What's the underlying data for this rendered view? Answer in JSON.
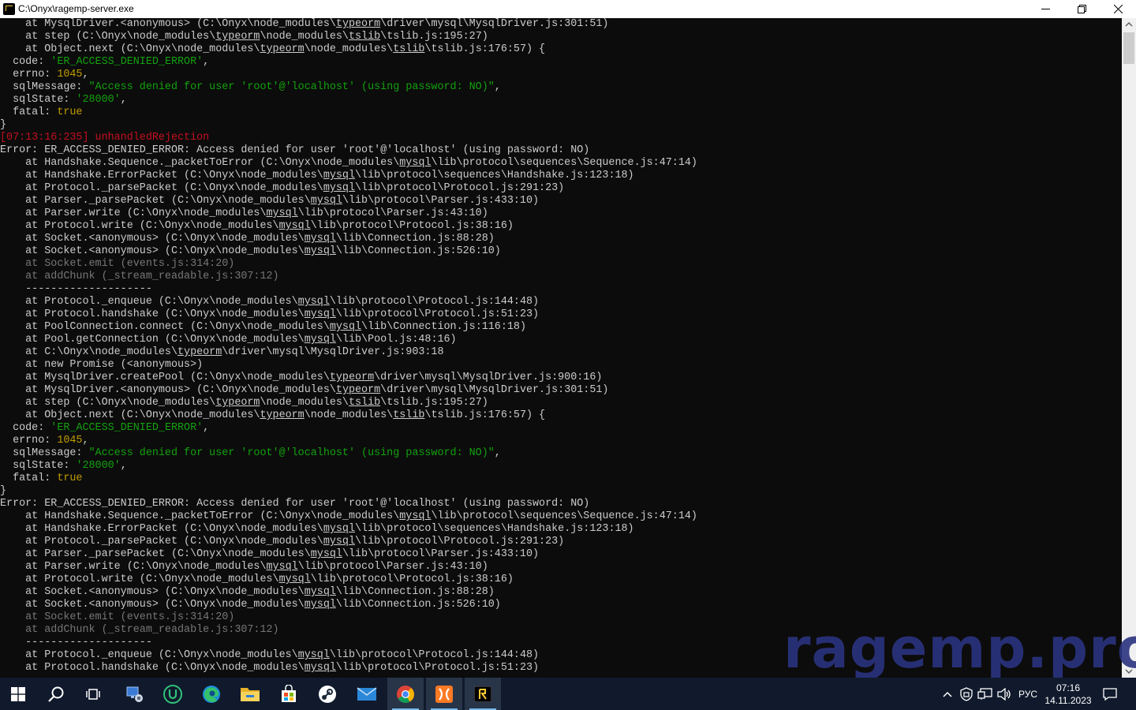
{
  "window": {
    "title": "C:\\Onyx\\ragemp-server.exe",
    "controls": {
      "minimize": "─",
      "maximize": "❐",
      "close": "✕"
    }
  },
  "console": {
    "lines": [
      [
        {
          "t": "    at MysqlDriver.<anonymous> (C:\\Onyx\\node_modules\\"
        },
        {
          "t": "typeorm",
          "u": 1
        },
        {
          "t": "\\driver\\mysql\\MysqlDriver.js:301:51)"
        }
      ],
      [
        {
          "t": "    at step (C:\\Onyx\\node_modules\\"
        },
        {
          "t": "typeorm",
          "u": 1
        },
        {
          "t": "\\node_modules\\"
        },
        {
          "t": "tslib",
          "u": 1
        },
        {
          "t": "\\tslib.js:195:27)"
        }
      ],
      [
        {
          "t": "    at Object.next (C:\\Onyx\\node_modules\\"
        },
        {
          "t": "typeorm",
          "u": 1
        },
        {
          "t": "\\node_modules\\"
        },
        {
          "t": "tslib",
          "u": 1
        },
        {
          "t": "\\tslib.js:176:57) {"
        }
      ],
      [
        {
          "t": "  code: "
        },
        {
          "t": "'ER_ACCESS_DENIED_ERROR'",
          "c": "g"
        },
        {
          "t": ","
        }
      ],
      [
        {
          "t": "  errno: "
        },
        {
          "t": "1045",
          "c": "y"
        },
        {
          "t": ","
        }
      ],
      [
        {
          "t": "  sqlMessage: "
        },
        {
          "t": "\"Access denied for user 'root'@'localhost' (using password: NO)\"",
          "c": "g"
        },
        {
          "t": ","
        }
      ],
      [
        {
          "t": "  sqlState: "
        },
        {
          "t": "'28000'",
          "c": "g"
        },
        {
          "t": ","
        }
      ],
      [
        {
          "t": "  fatal: "
        },
        {
          "t": "true",
          "c": "y"
        }
      ],
      [
        {
          "t": "}"
        }
      ],
      [
        {
          "t": "[07:13:16:235] unhandledRejection",
          "c": "r"
        }
      ],
      [
        {
          "t": "Error: ER_ACCESS_DENIED_ERROR: Access denied for user 'root'@'localhost' (using password: NO)"
        }
      ],
      [
        {
          "t": "    at Handshake.Sequence._packetToError (C:\\Onyx\\node_modules\\"
        },
        {
          "t": "mysql",
          "u": 1
        },
        {
          "t": "\\lib\\protocol\\sequences\\Sequence.js:47:14)"
        }
      ],
      [
        {
          "t": "    at Handshake.ErrorPacket (C:\\Onyx\\node_modules\\"
        },
        {
          "t": "mysql",
          "u": 1
        },
        {
          "t": "\\lib\\protocol\\sequences\\Handshake.js:123:18)"
        }
      ],
      [
        {
          "t": "    at Protocol._parsePacket (C:\\Onyx\\node_modules\\"
        },
        {
          "t": "mysql",
          "u": 1
        },
        {
          "t": "\\lib\\protocol\\Protocol.js:291:23)"
        }
      ],
      [
        {
          "t": "    at Parser._parsePacket (C:\\Onyx\\node_modules\\"
        },
        {
          "t": "mysql",
          "u": 1
        },
        {
          "t": "\\lib\\protocol\\Parser.js:433:10)"
        }
      ],
      [
        {
          "t": "    at Parser.write (C:\\Onyx\\node_modules\\"
        },
        {
          "t": "mysql",
          "u": 1
        },
        {
          "t": "\\lib\\protocol\\Parser.js:43:10)"
        }
      ],
      [
        {
          "t": "    at Protocol.write (C:\\Onyx\\node_modules\\"
        },
        {
          "t": "mysql",
          "u": 1
        },
        {
          "t": "\\lib\\protocol\\Protocol.js:38:16)"
        }
      ],
      [
        {
          "t": "    at Socket.<anonymous> (C:\\Onyx\\node_modules\\"
        },
        {
          "t": "mysql",
          "u": 1
        },
        {
          "t": "\\lib\\Connection.js:88:28)"
        }
      ],
      [
        {
          "t": "    at Socket.<anonymous> (C:\\Onyx\\node_modules\\"
        },
        {
          "t": "mysql",
          "u": 1
        },
        {
          "t": "\\lib\\Connection.js:526:10)"
        }
      ],
      [
        {
          "t": "    at Socket.emit (events.js:314:20)",
          "c": "d"
        }
      ],
      [
        {
          "t": "    at addChunk (_stream_readable.js:307:12)",
          "c": "d"
        }
      ],
      [
        {
          "t": "    --------------------"
        }
      ],
      [
        {
          "t": "    at Protocol._enqueue (C:\\Onyx\\node_modules\\"
        },
        {
          "t": "mysql",
          "u": 1
        },
        {
          "t": "\\lib\\protocol\\Protocol.js:144:48)"
        }
      ],
      [
        {
          "t": "    at Protocol.handshake (C:\\Onyx\\node_modules\\"
        },
        {
          "t": "mysql",
          "u": 1
        },
        {
          "t": "\\lib\\protocol\\Protocol.js:51:23)"
        }
      ],
      [
        {
          "t": "    at PoolConnection.connect (C:\\Onyx\\node_modules\\"
        },
        {
          "t": "mysql",
          "u": 1
        },
        {
          "t": "\\lib\\Connection.js:116:18)"
        }
      ],
      [
        {
          "t": "    at Pool.getConnection (C:\\Onyx\\node_modules\\"
        },
        {
          "t": "mysql",
          "u": 1
        },
        {
          "t": "\\lib\\Pool.js:48:16)"
        }
      ],
      [
        {
          "t": "    at C:\\Onyx\\node_modules\\"
        },
        {
          "t": "typeorm",
          "u": 1
        },
        {
          "t": "\\driver\\mysql\\MysqlDriver.js:903:18"
        }
      ],
      [
        {
          "t": "    at new Promise (<anonymous>)"
        }
      ],
      [
        {
          "t": "    at MysqlDriver.createPool (C:\\Onyx\\node_modules\\"
        },
        {
          "t": "typeorm",
          "u": 1
        },
        {
          "t": "\\driver\\mysql\\MysqlDriver.js:900:16)"
        }
      ],
      [
        {
          "t": "    at MysqlDriver.<anonymous> (C:\\Onyx\\node_modules\\"
        },
        {
          "t": "typeorm",
          "u": 1
        },
        {
          "t": "\\driver\\mysql\\MysqlDriver.js:301:51)"
        }
      ],
      [
        {
          "t": "    at step (C:\\Onyx\\node_modules\\"
        },
        {
          "t": "typeorm",
          "u": 1
        },
        {
          "t": "\\node_modules\\"
        },
        {
          "t": "tslib",
          "u": 1
        },
        {
          "t": "\\tslib.js:195:27)"
        }
      ],
      [
        {
          "t": "    at Object.next (C:\\Onyx\\node_modules\\"
        },
        {
          "t": "typeorm",
          "u": 1
        },
        {
          "t": "\\node_modules\\"
        },
        {
          "t": "tslib",
          "u": 1
        },
        {
          "t": "\\tslib.js:176:57) {"
        }
      ],
      [
        {
          "t": "  code: "
        },
        {
          "t": "'ER_ACCESS_DENIED_ERROR'",
          "c": "g"
        },
        {
          "t": ","
        }
      ],
      [
        {
          "t": "  errno: "
        },
        {
          "t": "1045",
          "c": "y"
        },
        {
          "t": ","
        }
      ],
      [
        {
          "t": "  sqlMessage: "
        },
        {
          "t": "\"Access denied for user 'root'@'localhost' (using password: NO)\"",
          "c": "g"
        },
        {
          "t": ","
        }
      ],
      [
        {
          "t": "  sqlState: "
        },
        {
          "t": "'28000'",
          "c": "g"
        },
        {
          "t": ","
        }
      ],
      [
        {
          "t": "  fatal: "
        },
        {
          "t": "true",
          "c": "y"
        }
      ],
      [
        {
          "t": "}"
        }
      ],
      [
        {
          "t": "Error: ER_ACCESS_DENIED_ERROR: Access denied for user 'root'@'localhost' (using password: NO)"
        }
      ],
      [
        {
          "t": "    at Handshake.Sequence._packetToError (C:\\Onyx\\node_modules\\"
        },
        {
          "t": "mysql",
          "u": 1
        },
        {
          "t": "\\lib\\protocol\\sequences\\Sequence.js:47:14)"
        }
      ],
      [
        {
          "t": "    at Handshake.ErrorPacket (C:\\Onyx\\node_modules\\"
        },
        {
          "t": "mysql",
          "u": 1
        },
        {
          "t": "\\lib\\protocol\\sequences\\Handshake.js:123:18)"
        }
      ],
      [
        {
          "t": "    at Protocol._parsePacket (C:\\Onyx\\node_modules\\"
        },
        {
          "t": "mysql",
          "u": 1
        },
        {
          "t": "\\lib\\protocol\\Protocol.js:291:23)"
        }
      ],
      [
        {
          "t": "    at Parser._parsePacket (C:\\Onyx\\node_modules\\"
        },
        {
          "t": "mysql",
          "u": 1
        },
        {
          "t": "\\lib\\protocol\\Parser.js:433:10)"
        }
      ],
      [
        {
          "t": "    at Parser.write (C:\\Onyx\\node_modules\\"
        },
        {
          "t": "mysql",
          "u": 1
        },
        {
          "t": "\\lib\\protocol\\Parser.js:43:10)"
        }
      ],
      [
        {
          "t": "    at Protocol.write (C:\\Onyx\\node_modules\\"
        },
        {
          "t": "mysql",
          "u": 1
        },
        {
          "t": "\\lib\\protocol\\Protocol.js:38:16)"
        }
      ],
      [
        {
          "t": "    at Socket.<anonymous> (C:\\Onyx\\node_modules\\"
        },
        {
          "t": "mysql",
          "u": 1
        },
        {
          "t": "\\lib\\Connection.js:88:28)"
        }
      ],
      [
        {
          "t": "    at Socket.<anonymous> (C:\\Onyx\\node_modules\\"
        },
        {
          "t": "mysql",
          "u": 1
        },
        {
          "t": "\\lib\\Connection.js:526:10)"
        }
      ],
      [
        {
          "t": "    at Socket.emit (events.js:314:20)",
          "c": "d"
        }
      ],
      [
        {
          "t": "    at addChunk (_stream_readable.js:307:12)",
          "c": "d"
        }
      ],
      [
        {
          "t": "    --------------------"
        }
      ],
      [
        {
          "t": "    at Protocol._enqueue (C:\\Onyx\\node_modules\\"
        },
        {
          "t": "mysql",
          "u": 1
        },
        {
          "t": "\\lib\\protocol\\Protocol.js:144:48)"
        }
      ],
      [
        {
          "t": "    at Protocol.handshake (C:\\Onyx\\node_modules\\"
        },
        {
          "t": "mysql",
          "u": 1
        },
        {
          "t": "\\lib\\protocol\\Protocol.js:51:23)"
        }
      ]
    ]
  },
  "watermark": "ragemp.pro",
  "taskbar": {
    "apps": [
      {
        "name": "start-button",
        "icon": "windows-logo-icon"
      },
      {
        "name": "search-button",
        "icon": "search-icon"
      },
      {
        "name": "task-view-button",
        "icon": "task-view-icon"
      },
      {
        "name": "taskbar-app-network-tool",
        "icon": "network-monitor-icon"
      },
      {
        "name": "taskbar-app-u-client",
        "icon": "u-logo-icon"
      },
      {
        "name": "taskbar-app-edge",
        "icon": "edge-icon"
      },
      {
        "name": "taskbar-app-file-explorer",
        "icon": "folder-icon"
      },
      {
        "name": "taskbar-app-store",
        "icon": "store-icon"
      },
      {
        "name": "taskbar-app-steam",
        "icon": "steam-icon"
      },
      {
        "name": "taskbar-app-mail",
        "icon": "mail-icon"
      },
      {
        "name": "taskbar-app-chrome",
        "icon": "chrome-icon"
      },
      {
        "name": "taskbar-app-xampp",
        "icon": "xampp-icon"
      },
      {
        "name": "taskbar-app-ragemp-server",
        "icon": "ragemp-icon",
        "active": true
      }
    ],
    "tray": {
      "language": "РУС",
      "time": "07:16",
      "date": "14.11.2023"
    }
  },
  "colors": {
    "console_bg": "#0c0c0c",
    "console_text": "#cccccc",
    "string_green": "#13a10e",
    "number_yellow": "#c19c00",
    "error_red": "#c50f1f",
    "dim_gray": "#767676",
    "taskbar_bg": "#101a2c",
    "watermark": "#2b3380"
  }
}
